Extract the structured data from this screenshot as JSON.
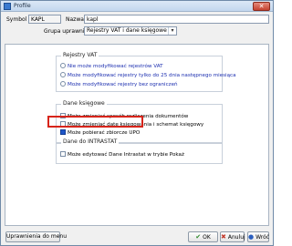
{
  "window": {
    "title": "Profile",
    "close": "✕"
  },
  "header": {
    "symbol_label": "Symbol",
    "symbol_value": "KAPL",
    "name_label": "Nazwa",
    "name_value": "kapl",
    "group_label": "Grupa uprawnień",
    "group_value": "Rejestry VAT i dane księgowe"
  },
  "groups": {
    "vat": {
      "title": "Rejestry VAT",
      "options": [
        {
          "label": "Nie może modyfikować rejestrów VAT"
        },
        {
          "label": "Może modyfikować rejestry tylko do 25 dnia następnego miesiąca"
        },
        {
          "label": "Może modyfikować rejestry bez ograniczeń"
        }
      ]
    },
    "ksiegowe": {
      "title": "Dane księgowe",
      "options": [
        {
          "label": "Może zmieniać sposób rozliczenia dokumentów",
          "checked": false
        },
        {
          "label": "Może zmieniać datę księgowania i schemat księgowy",
          "checked": false
        },
        {
          "label": "Może pobierać zbiorcze UPO",
          "checked": true
        }
      ]
    },
    "intrastat": {
      "title": "Dane do INTRASTAT",
      "options": [
        {
          "label": "Może edytować Dane Intrastat w trybie Pokaż",
          "checked": false
        }
      ]
    }
  },
  "footer": {
    "menu_permissions": "Uprawnienia do menu",
    "ok": "OK",
    "cancel": "Anuluj",
    "help": "Wróć"
  }
}
